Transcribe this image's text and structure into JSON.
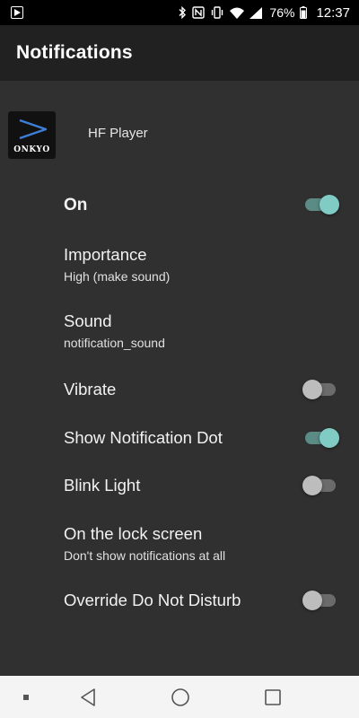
{
  "status_bar": {
    "battery_percent": "76%",
    "time": "12:37",
    "icons": [
      "play-store-icon",
      "bluetooth-icon",
      "nfc-icon",
      "vibrate-icon",
      "wifi-icon",
      "signal-icon",
      "battery-icon"
    ]
  },
  "app_bar": {
    "title": "Notifications"
  },
  "app": {
    "name": "HF Player",
    "icon_brand": "ONKYO",
    "icon_accent": "#3d7fd6"
  },
  "settings": [
    {
      "title": "On",
      "type": "toggle",
      "checked": true
    },
    {
      "title": "Importance",
      "summary": "High (make sound)",
      "type": "item"
    },
    {
      "title": "Sound",
      "summary": "notification_sound",
      "type": "item"
    },
    {
      "title": "Vibrate",
      "type": "toggle",
      "checked": false
    },
    {
      "title": "Show Notification Dot",
      "type": "toggle",
      "checked": true
    },
    {
      "title": "Blink Light",
      "type": "toggle",
      "checked": false
    },
    {
      "title": "On the lock screen",
      "summary": "Don't show notifications at all",
      "type": "item"
    },
    {
      "title": "Override Do Not Disturb",
      "type": "toggle",
      "checked": false
    }
  ],
  "nav_bar": {
    "icons": [
      "recents-dot-icon",
      "back-icon",
      "home-icon",
      "overview-icon"
    ]
  },
  "colors": {
    "background": "#303030",
    "app_bar": "#212121",
    "toggle_on_thumb": "#80cbc4",
    "toggle_on_track": "#5b8b85",
    "toggle_off_thumb": "#bdbdbd"
  }
}
